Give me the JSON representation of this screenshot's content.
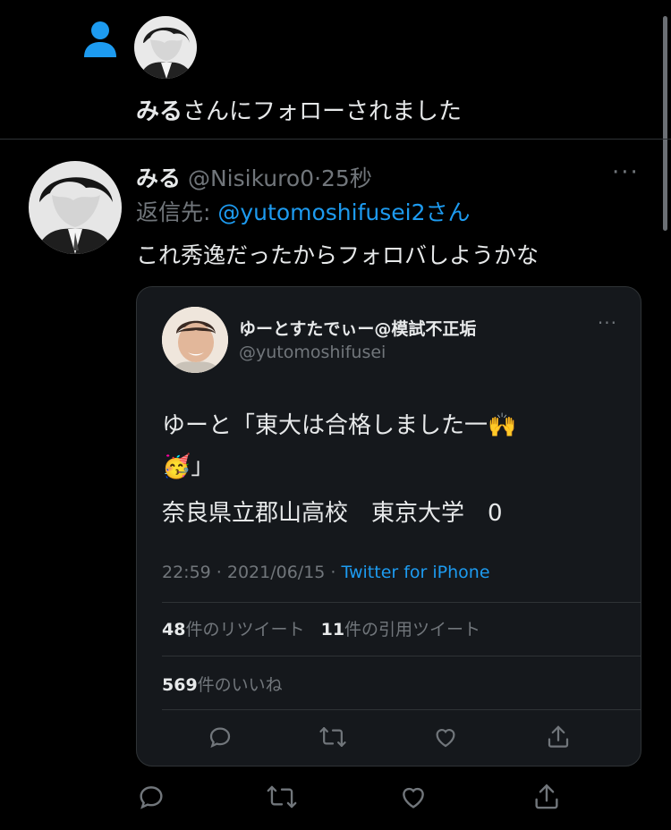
{
  "notification": {
    "name": "みる",
    "text": "さんにフォローされました"
  },
  "tweet": {
    "name": "みる",
    "handle": "@Nisikuro0",
    "separator": "·",
    "time": "25秒",
    "more": "···",
    "reply_prefix": "返信先:",
    "reply_to": "@yutomoshifusei2さん",
    "text": "これ秀逸だったからフォロバしようかな"
  },
  "quote": {
    "name": "ゆーとすたでぃー@模試不正垢",
    "handle": "@yutomoshifusei",
    "more": "···",
    "line1": "ゆーと「東大は合格しました一🙌",
    "line2": "🥳」",
    "line3": "奈良県立郡山高校　東京大学　0",
    "timestamp": "22:59 · 2021/06/15 · ",
    "source": "Twitter for iPhone",
    "retweet_count": "48",
    "retweet_label": "件のリツイート",
    "quote_count": "11",
    "quote_label": "件の引用ツイート",
    "like_count": "569",
    "like_label": "件のいいね"
  },
  "colors": {
    "background": "#000000",
    "text": "#e7e9ea",
    "muted": "#71767b",
    "accent": "#1d9bf0",
    "card": "#15181c",
    "border": "#2f3336"
  },
  "icons": [
    "person-icon",
    "reply-icon",
    "retweet-icon",
    "like-icon",
    "share-icon"
  ]
}
